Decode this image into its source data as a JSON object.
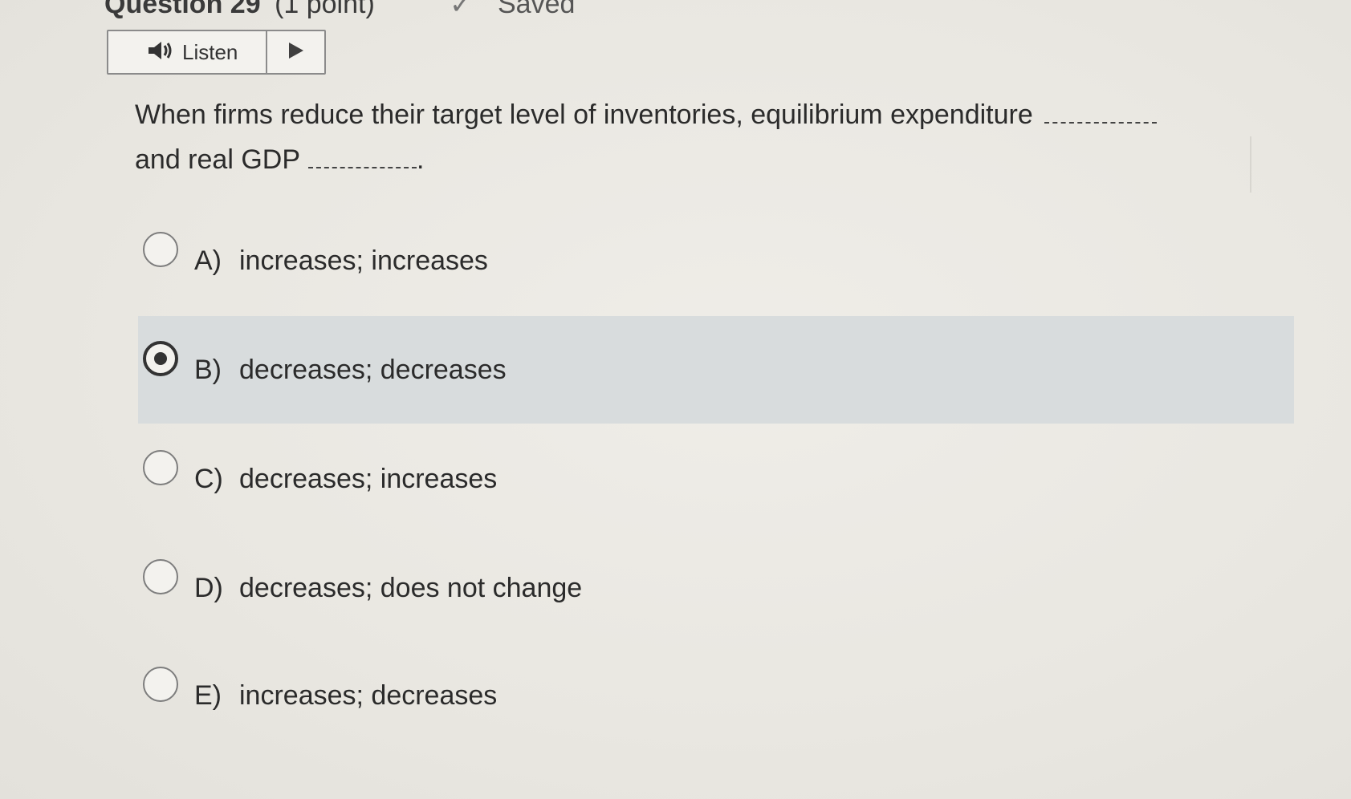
{
  "header": {
    "title": "Question 29",
    "points": "(1 point)",
    "saved": "Saved"
  },
  "listen": {
    "label": "Listen",
    "speaker_icon": "speaker-icon",
    "play_icon": "play-icon"
  },
  "question": {
    "part1": "When firms reduce their target level of inventories, equilibrium expenditure",
    "part2": "and real GDP",
    "end": "."
  },
  "options": [
    {
      "letter": "A)",
      "text": "increases; increases",
      "selected": false
    },
    {
      "letter": "B)",
      "text": "decreases; decreases",
      "selected": true
    },
    {
      "letter": "C)",
      "text": "decreases; increases",
      "selected": false
    },
    {
      "letter": "D)",
      "text": "decreases; does not change",
      "selected": false
    },
    {
      "letter": "E)",
      "text": "increases; decreases",
      "selected": false
    }
  ]
}
